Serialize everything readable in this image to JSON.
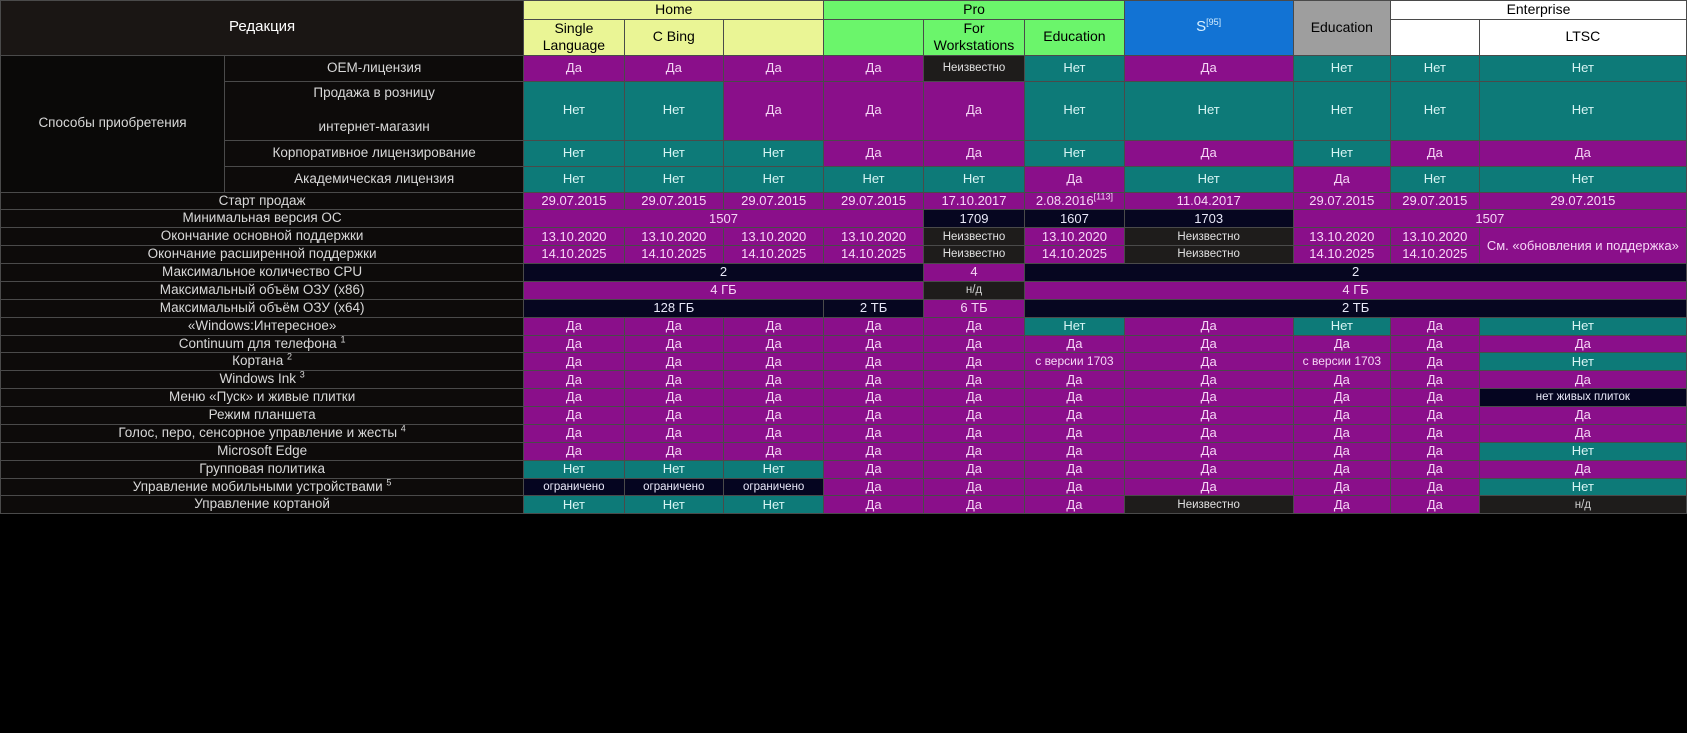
{
  "header": {
    "edition_label": "Редакция",
    "groups": [
      {
        "name": "Home",
        "color": "#eaf595"
      },
      {
        "name": "Pro",
        "color": "#6bf56b"
      },
      {
        "name": "S",
        "ref": "[95]",
        "color": "#1273d4"
      },
      {
        "name": "Education",
        "color": "#9e9e9e"
      },
      {
        "name": "Enterprise",
        "color": "#ffffff"
      }
    ],
    "subcolumns": [
      "Single Language",
      "C Bing",
      "",
      "",
      "For Workstations",
      "Education",
      "",
      "",
      "",
      "LTSC"
    ]
  },
  "sections": {
    "acquisition": {
      "label": "Способы приобретения",
      "rows": [
        {
          "label": "OEM-лицензия",
          "cells": [
            {
              "t": "Да",
              "s": "yes"
            },
            {
              "t": "Да",
              "s": "yes"
            },
            {
              "t": "Да",
              "s": "yes"
            },
            {
              "t": "Да",
              "s": "yes"
            },
            {
              "t": "Неизвестно",
              "s": "unk"
            },
            {
              "t": "Нет",
              "s": "no"
            },
            {
              "t": "Да",
              "s": "yes"
            },
            {
              "t": "Нет",
              "s": "no"
            },
            {
              "t": "Нет",
              "s": "no"
            },
            {
              "t": "Нет",
              "s": "no"
            }
          ]
        },
        {
          "label": "Продажа в розницу",
          "label2": "интернет-магазин",
          "cells": [
            {
              "t": "Нет",
              "s": "no"
            },
            {
              "t": "Нет",
              "s": "no"
            },
            {
              "t": "Да",
              "s": "yes"
            },
            {
              "t": "Да",
              "s": "yes"
            },
            {
              "t": "Да",
              "s": "yes"
            },
            {
              "t": "Нет",
              "s": "no"
            },
            {
              "t": "Нет",
              "s": "no"
            },
            {
              "t": "Нет",
              "s": "no"
            },
            {
              "t": "Нет",
              "s": "no"
            },
            {
              "t": "Нет",
              "s": "no"
            }
          ]
        },
        {
          "label": "Корпоративное лицензирование",
          "cells": [
            {
              "t": "Нет",
              "s": "no"
            },
            {
              "t": "Нет",
              "s": "no"
            },
            {
              "t": "Нет",
              "s": "no"
            },
            {
              "t": "Да",
              "s": "yes"
            },
            {
              "t": "Да",
              "s": "yes"
            },
            {
              "t": "Нет",
              "s": "no"
            },
            {
              "t": "Да",
              "s": "yes"
            },
            {
              "t": "Нет",
              "s": "no"
            },
            {
              "t": "Да",
              "s": "yes"
            },
            {
              "t": "Да",
              "s": "yes"
            }
          ]
        },
        {
          "label": "Академическая лицензия",
          "cells": [
            {
              "t": "Нет",
              "s": "no"
            },
            {
              "t": "Нет",
              "s": "no"
            },
            {
              "t": "Нет",
              "s": "no"
            },
            {
              "t": "Нет",
              "s": "no"
            },
            {
              "t": "Нет",
              "s": "no"
            },
            {
              "t": "Да",
              "s": "yes"
            },
            {
              "t": "Нет",
              "s": "no"
            },
            {
              "t": "Да",
              "s": "yes"
            },
            {
              "t": "Нет",
              "s": "no"
            },
            {
              "t": "Нет",
              "s": "no"
            }
          ]
        }
      ]
    }
  },
  "rows": [
    {
      "label": "Старт продаж",
      "cells": [
        {
          "t": "29.07.2015",
          "s": "yes"
        },
        {
          "t": "29.07.2015",
          "s": "yes"
        },
        {
          "t": "29.07.2015",
          "s": "yes"
        },
        {
          "t": "29.07.2015",
          "s": "yes"
        },
        {
          "t": "17.10.2017",
          "s": "yes"
        },
        {
          "t": "2.08.2016",
          "ref": "[113]",
          "s": "yes"
        },
        {
          "t": "11.04.2017",
          "s": "yes"
        },
        {
          "t": "29.07.2015",
          "s": "yes"
        },
        {
          "t": "29.07.2015",
          "s": "yes"
        },
        {
          "t": "29.07.2015",
          "s": "yes"
        }
      ]
    },
    {
      "label": "Минимальная версия ОС",
      "cells": [
        {
          "t": "1507",
          "s": "yes",
          "span": 4
        },
        {
          "t": "1709",
          "s": "darkblue"
        },
        {
          "t": "1607",
          "s": "darkblue"
        },
        {
          "t": "1703",
          "s": "darkblue"
        },
        {
          "t": "1507",
          "s": "yes",
          "span": 3
        }
      ]
    },
    {
      "label": "Окончание основной поддержки",
      "cells": [
        {
          "t": "13.10.2020",
          "s": "yes"
        },
        {
          "t": "13.10.2020",
          "s": "yes"
        },
        {
          "t": "13.10.2020",
          "s": "yes"
        },
        {
          "t": "13.10.2020",
          "s": "yes"
        },
        {
          "t": "Неизвестно",
          "s": "unk"
        },
        {
          "t": "13.10.2020",
          "s": "yes"
        },
        {
          "t": "Неизвестно",
          "s": "unk"
        },
        {
          "t": "13.10.2020",
          "s": "yes"
        },
        {
          "t": "13.10.2020",
          "s": "yes"
        },
        {
          "t": "См. «обновления и поддержка»",
          "s": "yes",
          "rowspan": 2
        }
      ]
    },
    {
      "label": "Окончание расширенной поддержки",
      "cells": [
        {
          "t": "14.10.2025",
          "s": "yes"
        },
        {
          "t": "14.10.2025",
          "s": "yes"
        },
        {
          "t": "14.10.2025",
          "s": "yes"
        },
        {
          "t": "14.10.2025",
          "s": "yes"
        },
        {
          "t": "Неизвестно",
          "s": "unk"
        },
        {
          "t": "14.10.2025",
          "s": "yes"
        },
        {
          "t": "Неизвестно",
          "s": "unk"
        },
        {
          "t": "14.10.2025",
          "s": "yes"
        },
        {
          "t": "14.10.2025",
          "s": "yes"
        }
      ]
    },
    {
      "label": "Максимальное количество CPU",
      "cells": [
        {
          "t": "2",
          "s": "darkblue",
          "span": 4
        },
        {
          "t": "4",
          "s": "yes"
        },
        {
          "t": "2",
          "s": "darkblue",
          "span": 5
        }
      ]
    },
    {
      "label": "Максимальный объём ОЗУ (x86)",
      "cells": [
        {
          "t": "4 ГБ",
          "s": "yes",
          "span": 4
        },
        {
          "t": "н/д",
          "s": "na"
        },
        {
          "t": "4 ГБ",
          "s": "yes",
          "span": 5
        }
      ]
    },
    {
      "label": "Максимальный объём ОЗУ (x64)",
      "cells": [
        {
          "t": "128 ГБ",
          "s": "darkblue",
          "span": 3
        },
        {
          "t": "2 ТБ",
          "s": "darkblue"
        },
        {
          "t": "6 ТБ",
          "s": "yes"
        },
        {
          "t": "2 ТБ",
          "s": "darkblue",
          "span": 5
        }
      ]
    },
    {
      "label": "«Windows:Интересное»",
      "cells": [
        {
          "t": "Да",
          "s": "yes"
        },
        {
          "t": "Да",
          "s": "yes"
        },
        {
          "t": "Да",
          "s": "yes"
        },
        {
          "t": "Да",
          "s": "yes"
        },
        {
          "t": "Да",
          "s": "yes"
        },
        {
          "t": "Нет",
          "s": "no"
        },
        {
          "t": "Да",
          "s": "yes"
        },
        {
          "t": "Нет",
          "s": "no"
        },
        {
          "t": "Да",
          "s": "yes"
        },
        {
          "t": "Нет",
          "s": "no"
        }
      ]
    },
    {
      "label": "Continuum для телефона",
      "sup": "1",
      "cells": [
        {
          "t": "Да",
          "s": "yes"
        },
        {
          "t": "Да",
          "s": "yes"
        },
        {
          "t": "Да",
          "s": "yes"
        },
        {
          "t": "Да",
          "s": "yes"
        },
        {
          "t": "Да",
          "s": "yes"
        },
        {
          "t": "Да",
          "s": "yes"
        },
        {
          "t": "Да",
          "s": "yes"
        },
        {
          "t": "Да",
          "s": "yes"
        },
        {
          "t": "Да",
          "s": "yes"
        },
        {
          "t": "Да",
          "s": "yes"
        }
      ]
    },
    {
      "label": "Кортана",
      "sup": "2",
      "cells": [
        {
          "t": "Да",
          "s": "yes"
        },
        {
          "t": "Да",
          "s": "yes"
        },
        {
          "t": "Да",
          "s": "yes"
        },
        {
          "t": "Да",
          "s": "yes"
        },
        {
          "t": "Да",
          "s": "yes"
        },
        {
          "t": "с версии 1703",
          "s": "yes two-line"
        },
        {
          "t": "Да",
          "s": "yes"
        },
        {
          "t": "с версии 1703",
          "s": "yes two-line"
        },
        {
          "t": "Да",
          "s": "yes"
        },
        {
          "t": "Нет",
          "s": "no"
        }
      ]
    },
    {
      "label": "Windows Ink",
      "sup": "3",
      "cells": [
        {
          "t": "Да",
          "s": "yes"
        },
        {
          "t": "Да",
          "s": "yes"
        },
        {
          "t": "Да",
          "s": "yes"
        },
        {
          "t": "Да",
          "s": "yes"
        },
        {
          "t": "Да",
          "s": "yes"
        },
        {
          "t": "Да",
          "s": "yes"
        },
        {
          "t": "Да",
          "s": "yes"
        },
        {
          "t": "Да",
          "s": "yes"
        },
        {
          "t": "Да",
          "s": "yes"
        },
        {
          "t": "Да",
          "s": "yes"
        }
      ]
    },
    {
      "label": "Меню «Пуск» и живые плитки",
      "cells": [
        {
          "t": "Да",
          "s": "yes"
        },
        {
          "t": "Да",
          "s": "yes"
        },
        {
          "t": "Да",
          "s": "yes"
        },
        {
          "t": "Да",
          "s": "yes"
        },
        {
          "t": "Да",
          "s": "yes"
        },
        {
          "t": "Да",
          "s": "yes"
        },
        {
          "t": "Да",
          "s": "yes"
        },
        {
          "t": "Да",
          "s": "yes"
        },
        {
          "t": "Да",
          "s": "yes"
        },
        {
          "t": "нет живых плиток",
          "s": "notiles"
        }
      ]
    },
    {
      "label": "Режим планшета",
      "cells": [
        {
          "t": "Да",
          "s": "yes"
        },
        {
          "t": "Да",
          "s": "yes"
        },
        {
          "t": "Да",
          "s": "yes"
        },
        {
          "t": "Да",
          "s": "yes"
        },
        {
          "t": "Да",
          "s": "yes"
        },
        {
          "t": "Да",
          "s": "yes"
        },
        {
          "t": "Да",
          "s": "yes"
        },
        {
          "t": "Да",
          "s": "yes"
        },
        {
          "t": "Да",
          "s": "yes"
        },
        {
          "t": "Да",
          "s": "yes"
        }
      ]
    },
    {
      "label": "Голос, перо, сенсорное управление и жесты",
      "sup": "4",
      "cells": [
        {
          "t": "Да",
          "s": "yes"
        },
        {
          "t": "Да",
          "s": "yes"
        },
        {
          "t": "Да",
          "s": "yes"
        },
        {
          "t": "Да",
          "s": "yes"
        },
        {
          "t": "Да",
          "s": "yes"
        },
        {
          "t": "Да",
          "s": "yes"
        },
        {
          "t": "Да",
          "s": "yes"
        },
        {
          "t": "Да",
          "s": "yes"
        },
        {
          "t": "Да",
          "s": "yes"
        },
        {
          "t": "Да",
          "s": "yes"
        }
      ]
    },
    {
      "label": "Microsoft Edge",
      "cells": [
        {
          "t": "Да",
          "s": "yes"
        },
        {
          "t": "Да",
          "s": "yes"
        },
        {
          "t": "Да",
          "s": "yes"
        },
        {
          "t": "Да",
          "s": "yes"
        },
        {
          "t": "Да",
          "s": "yes"
        },
        {
          "t": "Да",
          "s": "yes"
        },
        {
          "t": "Да",
          "s": "yes"
        },
        {
          "t": "Да",
          "s": "yes"
        },
        {
          "t": "Да",
          "s": "yes"
        },
        {
          "t": "Нет",
          "s": "no"
        }
      ]
    },
    {
      "label": "Групповая политика",
      "cells": [
        {
          "t": "Нет",
          "s": "no"
        },
        {
          "t": "Нет",
          "s": "no"
        },
        {
          "t": "Нет",
          "s": "no"
        },
        {
          "t": "Да",
          "s": "yes"
        },
        {
          "t": "Да",
          "s": "yes"
        },
        {
          "t": "Да",
          "s": "yes"
        },
        {
          "t": "Да",
          "s": "yes"
        },
        {
          "t": "Да",
          "s": "yes"
        },
        {
          "t": "Да",
          "s": "yes"
        },
        {
          "t": "Да",
          "s": "yes"
        }
      ]
    },
    {
      "label": "Управление мобильными устройствами",
      "sup": "5",
      "cells": [
        {
          "t": "ограничено",
          "s": "notiles"
        },
        {
          "t": "ограничено",
          "s": "notiles"
        },
        {
          "t": "ограничено",
          "s": "notiles"
        },
        {
          "t": "Да",
          "s": "yes"
        },
        {
          "t": "Да",
          "s": "yes"
        },
        {
          "t": "Да",
          "s": "yes"
        },
        {
          "t": "Да",
          "s": "yes"
        },
        {
          "t": "Да",
          "s": "yes"
        },
        {
          "t": "Да",
          "s": "yes"
        },
        {
          "t": "Нет",
          "s": "no"
        }
      ]
    },
    {
      "label": "Управление кортаной",
      "cells": [
        {
          "t": "Нет",
          "s": "no"
        },
        {
          "t": "Нет",
          "s": "no"
        },
        {
          "t": "Нет",
          "s": "no"
        },
        {
          "t": "Да",
          "s": "yes"
        },
        {
          "t": "Да",
          "s": "yes"
        },
        {
          "t": "Да",
          "s": "yes"
        },
        {
          "t": "Неизвестно",
          "s": "unk"
        },
        {
          "t": "Да",
          "s": "yes"
        },
        {
          "t": "Да",
          "s": "yes"
        },
        {
          "t": "н/д",
          "s": "na"
        }
      ]
    }
  ]
}
